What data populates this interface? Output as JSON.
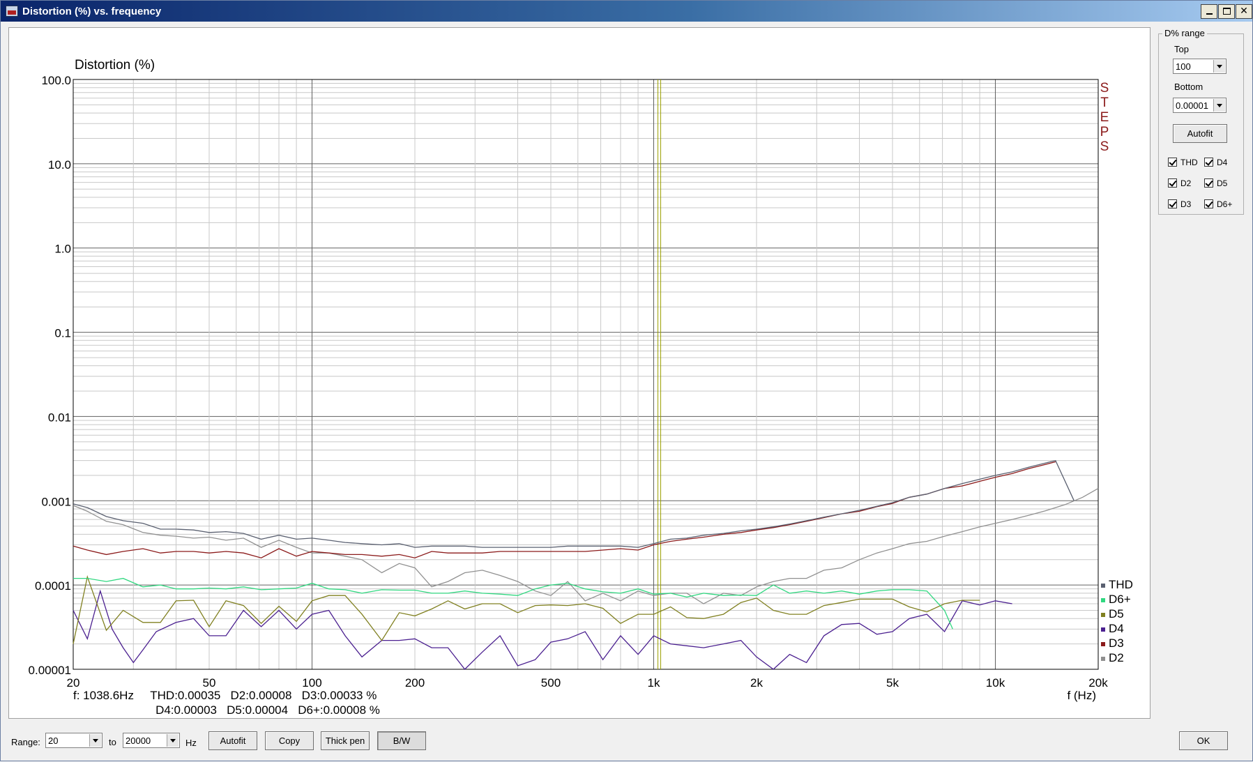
{
  "window": {
    "title": "Distortion (%) vs. frequency",
    "minimize_glyph": "0",
    "maximize_glyph": "1",
    "close_glyph": "r"
  },
  "range_panel": {
    "title": "D% range",
    "top_label": "Top",
    "top_value": "100",
    "bottom_label": "Bottom",
    "bottom_value": "0.00001",
    "autofit_label": "Autofit",
    "checks": [
      {
        "label": "THD",
        "checked": true
      },
      {
        "label": "D4",
        "checked": true
      },
      {
        "label": "D2",
        "checked": true
      },
      {
        "label": "D5",
        "checked": true
      },
      {
        "label": "D3",
        "checked": true
      },
      {
        "label": "D6+",
        "checked": true
      }
    ]
  },
  "readout": {
    "line1": "f: 1038.6Hz     THD:0.00035   D2:0.00008   D3:0.00033 %",
    "line2": "                         D4:0.00003   D5:0.00004   D6+:0.00008 %"
  },
  "bottom_bar": {
    "range_label": "Range:",
    "range_from": "20",
    "to_label": "to",
    "range_to": "20000",
    "unit_label": "Hz",
    "autofit_label": "Autofit",
    "copy_label": "Copy",
    "thick_pen_label": "Thick pen",
    "bw_label": "B/W",
    "ok_label": "OK"
  },
  "chart_data": {
    "type": "line",
    "ylabel": "Distortion (%)",
    "xlabel": "f (Hz)",
    "x_scale": "log",
    "y_scale": "log",
    "xlim": [
      20,
      20000
    ],
    "ylim": [
      1e-05,
      100
    ],
    "grid": true,
    "x_tick_labels": [
      {
        "value": 20,
        "label": "20"
      },
      {
        "value": 50,
        "label": "50"
      },
      {
        "value": 100,
        "label": "100"
      },
      {
        "value": 200,
        "label": "200"
      },
      {
        "value": 500,
        "label": "500"
      },
      {
        "value": 1000,
        "label": "1k"
      },
      {
        "value": 2000,
        "label": "2k"
      },
      {
        "value": 5000,
        "label": "5k"
      },
      {
        "value": 10000,
        "label": "10k"
      },
      {
        "value": 20000,
        "label": "20k"
      }
    ],
    "y_tick_labels": [
      {
        "value": 100,
        "label": "100.0"
      },
      {
        "value": 10,
        "label": "10.0"
      },
      {
        "value": 1,
        "label": "1.0"
      },
      {
        "value": 0.1,
        "label": "0.1"
      },
      {
        "value": 0.01,
        "label": "0.01"
      },
      {
        "value": 0.001,
        "label": "0.001"
      },
      {
        "value": 0.0001,
        "label": "0.0001"
      },
      {
        "value": 1e-05,
        "label": "0.00001"
      }
    ],
    "cursor_x": 1038.6,
    "watermark": "STEPS",
    "legend_position": "bottom-right",
    "series": [
      {
        "name": "THD",
        "color": "#5a6070",
        "x": [
          20,
          22,
          25,
          28,
          32,
          36,
          40,
          45,
          50,
          56,
          63,
          71,
          80,
          90,
          100,
          112,
          125,
          140,
          160,
          180,
          200,
          224,
          250,
          280,
          315,
          355,
          400,
          450,
          500,
          560,
          630,
          710,
          800,
          900,
          1000,
          1120,
          1250,
          1400,
          1600,
          1800,
          2000,
          2240,
          2500,
          2800,
          3150,
          3550,
          4000,
          4500,
          5000,
          5600,
          6300,
          7100,
          8000,
          9000,
          10000,
          11200,
          12500,
          14000,
          15000,
          17000
        ],
        "values": [
          0.00092,
          0.00083,
          0.00065,
          0.00058,
          0.00054,
          0.00046,
          0.00046,
          0.00045,
          0.00042,
          0.00043,
          0.00041,
          0.00035,
          0.00039,
          0.00035,
          0.00036,
          0.00034,
          0.00032,
          0.00031,
          0.0003,
          0.00031,
          0.00028,
          0.00029,
          0.00029,
          0.00029,
          0.00028,
          0.00028,
          0.00028,
          0.00028,
          0.00028,
          0.00029,
          0.00029,
          0.00029,
          0.00029,
          0.00028,
          0.00031,
          0.00035,
          0.00036,
          0.00039,
          0.00041,
          0.00044,
          0.00046,
          0.00049,
          0.00053,
          0.00058,
          0.00064,
          0.0007,
          0.00077,
          0.00086,
          0.00095,
          0.0011,
          0.0012,
          0.0014,
          0.0016,
          0.0018,
          0.002,
          0.0022,
          0.0025,
          0.0028,
          0.003,
          0.001
        ]
      },
      {
        "name": "D6+",
        "color": "#30d880",
        "x": [
          20,
          22,
          25,
          28,
          32,
          36,
          40,
          45,
          50,
          56,
          63,
          71,
          80,
          90,
          100,
          112,
          125,
          140,
          160,
          180,
          200,
          224,
          250,
          280,
          315,
          355,
          400,
          450,
          500,
          560,
          630,
          710,
          800,
          900,
          1000,
          1120,
          1250,
          1400,
          1600,
          1800,
          2000,
          2240,
          2500,
          2800,
          3150,
          3550,
          4000,
          4500,
          5000,
          5600,
          6300,
          7100,
          7500
        ],
        "values": [
          0.00012,
          0.00012,
          0.00011,
          0.00012,
          9.5e-05,
          0.0001,
          9e-05,
          9e-05,
          9.2e-05,
          9e-05,
          9.5e-05,
          8.8e-05,
          9e-05,
          9.2e-05,
          0.000105,
          9e-05,
          8.8e-05,
          8e-05,
          8.8e-05,
          8.7e-05,
          8.7e-05,
          8e-05,
          8e-05,
          8.5e-05,
          8e-05,
          7.8e-05,
          7.5e-05,
          9e-05,
          0.0001,
          0.000105,
          9e-05,
          8.3e-05,
          8e-05,
          9e-05,
          7.8e-05,
          8e-05,
          7.2e-05,
          8e-05,
          7.5e-05,
          7.6e-05,
          7.5e-05,
          0.0001,
          8e-05,
          8.5e-05,
          8e-05,
          8.5e-05,
          7.8e-05,
          8.5e-05,
          8.8e-05,
          8.8e-05,
          8.5e-05,
          5e-05,
          3e-05
        ]
      },
      {
        "name": "D5",
        "color": "#808020",
        "x": [
          20,
          22,
          25,
          28,
          32,
          36,
          40,
          45,
          50,
          56,
          63,
          71,
          80,
          90,
          100,
          112,
          125,
          140,
          160,
          180,
          200,
          224,
          250,
          280,
          315,
          355,
          400,
          450,
          500,
          560,
          630,
          710,
          800,
          900,
          1000,
          1120,
          1250,
          1400,
          1600,
          1800,
          2000,
          2240,
          2500,
          2800,
          3150,
          3550,
          4000,
          4500,
          5000,
          5600,
          6300,
          7100,
          8000,
          9000
        ],
        "values": [
          2e-05,
          0.000125,
          2.9e-05,
          5e-05,
          3.6e-05,
          3.6e-05,
          6.5e-05,
          6.6e-05,
          3.2e-05,
          6.5e-05,
          5.7e-05,
          3.5e-05,
          5.6e-05,
          3.7e-05,
          6.5e-05,
          7.5e-05,
          7.5e-05,
          4.5e-05,
          2.2e-05,
          4.7e-05,
          4.3e-05,
          5.2e-05,
          6.5e-05,
          5.2e-05,
          6e-05,
          6e-05,
          4.7e-05,
          5.7e-05,
          5.8e-05,
          5.7e-05,
          6e-05,
          5.3e-05,
          3.5e-05,
          4.5e-05,
          4.5e-05,
          5.5e-05,
          4.1e-05,
          4e-05,
          4.5e-05,
          6.2e-05,
          7e-05,
          5e-05,
          4.5e-05,
          4.5e-05,
          5.7e-05,
          6.2e-05,
          6.8e-05,
          6.8e-05,
          6.8e-05,
          5.5e-05,
          4.8e-05,
          6e-05,
          6.6e-05,
          6.6e-05
        ]
      },
      {
        "name": "D4",
        "color": "#4b2090",
        "x": [
          20,
          22,
          24,
          26,
          28,
          30,
          32,
          35,
          40,
          45,
          50,
          56,
          63,
          71,
          80,
          90,
          100,
          112,
          125,
          140,
          160,
          180,
          200,
          224,
          250,
          280,
          315,
          355,
          400,
          450,
          500,
          560,
          630,
          710,
          800,
          900,
          1000,
          1120,
          1250,
          1400,
          1600,
          1800,
          2000,
          2240,
          2500,
          2800,
          3150,
          3550,
          4000,
          4500,
          5000,
          5600,
          6300,
          7100,
          8000,
          9000,
          10000,
          11200
        ],
        "values": [
          5e-05,
          2.3e-05,
          8.5e-05,
          3e-05,
          1.8e-05,
          1.2e-05,
          1.7e-05,
          2.8e-05,
          3.6e-05,
          4e-05,
          2.5e-05,
          2.5e-05,
          5e-05,
          3.2e-05,
          5e-05,
          3e-05,
          4.5e-05,
          5e-05,
          2.5e-05,
          1.4e-05,
          2.2e-05,
          2.2e-05,
          2.3e-05,
          1.8e-05,
          1.8e-05,
          1e-05,
          1.6e-05,
          2.5e-05,
          1.1e-05,
          1.3e-05,
          2.1e-05,
          2.3e-05,
          2.8e-05,
          1.3e-05,
          2.5e-05,
          1.5e-05,
          2.5e-05,
          2e-05,
          1.9e-05,
          1.8e-05,
          2e-05,
          2.2e-05,
          1.4e-05,
          1e-05,
          1.5e-05,
          1.2e-05,
          2.5e-05,
          3.4e-05,
          3.5e-05,
          2.6e-05,
          2.8e-05,
          4e-05,
          4.5e-05,
          2.8e-05,
          6.5e-05,
          5.8e-05,
          6.5e-05,
          6e-05
        ]
      },
      {
        "name": "D3",
        "color": "#8b1a1a",
        "x": [
          20,
          22,
          25,
          28,
          32,
          36,
          40,
          45,
          50,
          56,
          63,
          71,
          80,
          90,
          100,
          112,
          125,
          140,
          160,
          180,
          200,
          224,
          250,
          280,
          315,
          355,
          400,
          450,
          500,
          560,
          630,
          710,
          800,
          900,
          1000,
          1120,
          1250,
          1400,
          1600,
          1800,
          2000,
          2240,
          2500,
          2800,
          3150,
          3550,
          4000,
          4500,
          5000,
          5600,
          6300,
          7100,
          8000,
          9000,
          10000,
          11200,
          12500,
          14000,
          15000
        ],
        "values": [
          0.00029,
          0.00026,
          0.00023,
          0.00025,
          0.00027,
          0.00024,
          0.00025,
          0.00025,
          0.00024,
          0.00025,
          0.00024,
          0.00021,
          0.00027,
          0.00022,
          0.00025,
          0.00024,
          0.00023,
          0.00023,
          0.00022,
          0.00023,
          0.00021,
          0.00025,
          0.00024,
          0.00024,
          0.00024,
          0.00025,
          0.00025,
          0.00025,
          0.00025,
          0.00025,
          0.00025,
          0.00026,
          0.00027,
          0.00026,
          0.0003,
          0.00033,
          0.00035,
          0.00037,
          0.0004,
          0.00042,
          0.00045,
          0.00048,
          0.00052,
          0.00057,
          0.00063,
          0.0007,
          0.00075,
          0.00085,
          0.00093,
          0.0011,
          0.0012,
          0.0014,
          0.0015,
          0.0017,
          0.0019,
          0.0021,
          0.0024,
          0.0027,
          0.0029
        ]
      },
      {
        "name": "D2",
        "color": "#909090",
        "x": [
          20,
          22,
          25,
          28,
          32,
          36,
          40,
          45,
          50,
          56,
          63,
          71,
          80,
          90,
          100,
          112,
          125,
          140,
          160,
          180,
          200,
          224,
          250,
          280,
          315,
          355,
          400,
          450,
          500,
          560,
          630,
          710,
          800,
          900,
          1000,
          1120,
          1250,
          1400,
          1600,
          1800,
          2000,
          2240,
          2500,
          2800,
          3150,
          3550,
          4000,
          4500,
          5000,
          5600,
          6300,
          7100,
          8000,
          9000,
          10000,
          11200,
          12500,
          14000,
          16000,
          18000,
          20000
        ],
        "values": [
          0.00088,
          0.00075,
          0.00057,
          0.00052,
          0.00042,
          0.00039,
          0.00038,
          0.00036,
          0.00037,
          0.00034,
          0.00036,
          0.00028,
          0.00034,
          0.00028,
          0.00024,
          0.00024,
          0.00022,
          0.0002,
          0.00014,
          0.00018,
          0.00016,
          9.5e-05,
          0.00011,
          0.00014,
          0.00015,
          0.00013,
          0.00011,
          8.5e-05,
          7.5e-05,
          0.00011,
          6.5e-05,
          8e-05,
          6.5e-05,
          8.5e-05,
          7.5e-05,
          8e-05,
          8e-05,
          6e-05,
          8e-05,
          7.5e-05,
          9.5e-05,
          0.00011,
          0.00012,
          0.00012,
          0.00015,
          0.00016,
          0.0002,
          0.00024,
          0.00027,
          0.00031,
          0.00033,
          0.00038,
          0.00043,
          0.00049,
          0.00054,
          0.0006,
          0.00067,
          0.00076,
          0.0009,
          0.0011,
          0.0014
        ]
      }
    ]
  }
}
